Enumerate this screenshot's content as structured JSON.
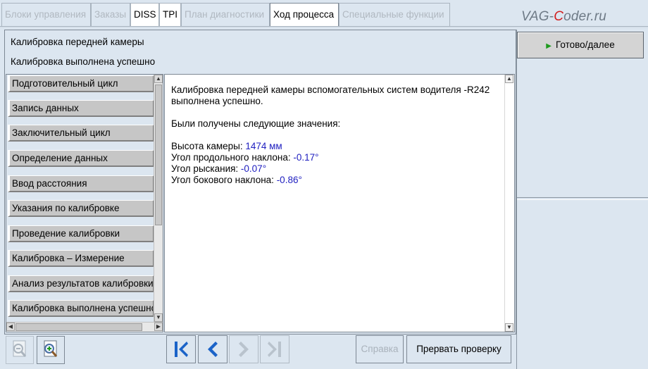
{
  "tabs": [
    {
      "label": "Блоки управления",
      "state": "disabled"
    },
    {
      "label": "Заказы",
      "state": "disabled"
    },
    {
      "label": "DISS",
      "state": "enabled"
    },
    {
      "label": "TPI",
      "state": "enabled"
    },
    {
      "label": "План диагностики",
      "state": "disabled"
    },
    {
      "label": "Ход процесса",
      "state": "active"
    },
    {
      "label": "Специальные функции",
      "state": "disabled"
    }
  ],
  "brand": {
    "prefix": "VAG-",
    "highlight": "C",
    "suffix": "oder.ru"
  },
  "header": {
    "title": "Калибровка передней камеры",
    "status": "Калибровка выполнена успешно"
  },
  "steps": [
    "Подготовительный цикл",
    "Запись данных",
    "Заключительный цикл",
    "Определение данных",
    "Ввод расстояния",
    "Указания по калибровке",
    "Проведение калибровки",
    "Калибровка – Измерение",
    "Анализ результатов калибровки",
    "Калибровка выполнена успешно"
  ],
  "content": {
    "message_line1": "Калибровка передней камеры вспомогательных систем водителя -R242",
    "message_line2": "выполнена успешно.",
    "values_intro": "Были получены следующие значения:",
    "rows": [
      {
        "label": "Высота камеры: ",
        "value": "1474 мм"
      },
      {
        "label": "Угол продольного наклона: ",
        "value": "-0.17°"
      },
      {
        "label": "Угол рыскания: ",
        "value": "-0.07°"
      },
      {
        "label": "Угол бокового наклона: ",
        "value": "-0.86°"
      }
    ]
  },
  "toolbar": {
    "help_label": "Справка",
    "abort_label": "Прервать проверку",
    "icons": [
      "zoom-out-icon",
      "zoom-in-icon",
      "first-icon",
      "previous-icon",
      "next-icon",
      "last-icon"
    ]
  },
  "right_panel": {
    "ready_label": "Готово/далее"
  },
  "colors": {
    "background": "#dce6f0",
    "value_text": "#2020c0",
    "nav_icon": "#1a63c8",
    "play_icon": "#1e9a1e",
    "brand_accent": "#d21e1e"
  }
}
